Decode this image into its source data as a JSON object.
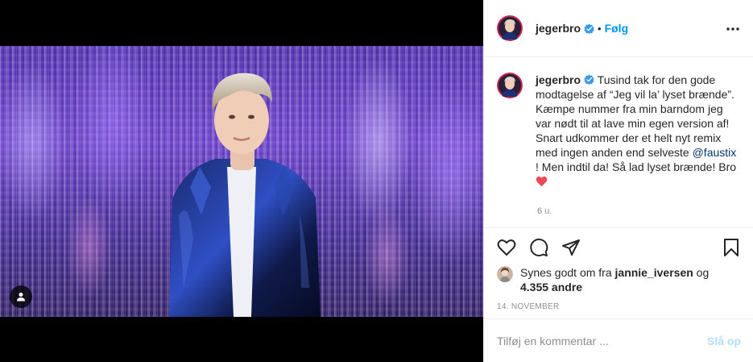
{
  "post": {
    "image_alt": "Young man with curly blond hair wearing a shiny blue jacket in front of a purple glitter curtain",
    "tag_icon": "user-icon"
  },
  "header": {
    "username": "jegerbro",
    "separator": "•",
    "follow_label": "Følg",
    "more_icon": "more-dots-icon",
    "verified_icon": "verified-badge-icon"
  },
  "caption": {
    "username": "jegerbro",
    "text_before_mention": "Tusind tak for den gode modtagelse af “Jeg vil la’ lyset brænde”. Kæmpe nummer fra min barndom jeg var nødt til at lave min egen version af! Snart udkommer der et helt nyt remix med ingen anden end selveste ",
    "mention": "@faustix",
    "text_after_mention": " ! Men indtil da! Så lad lyset brænde! Bro ",
    "emoji_icon": "red-heart-icon",
    "time_ago": "6 u."
  },
  "actions": {
    "like_icon": "heart-outline-icon",
    "comment_icon": "comment-icon",
    "share_icon": "share-icon",
    "save_icon": "bookmark-icon"
  },
  "likes": {
    "prefix": "Synes godt om fra ",
    "first_liker": "jannie_iversen",
    "connector": " og",
    "others": "4.355 andre"
  },
  "date": "14. NOVEMBER",
  "comment": {
    "placeholder": "Tilføj en kommentar ...",
    "post_label": "Slå op"
  },
  "colors": {
    "follow_blue": "#0095f6",
    "verified_blue": "#3897f0",
    "post_disabled": "#b2dffc",
    "mention_blue": "#00376b",
    "heart_red": "#ed4956"
  }
}
